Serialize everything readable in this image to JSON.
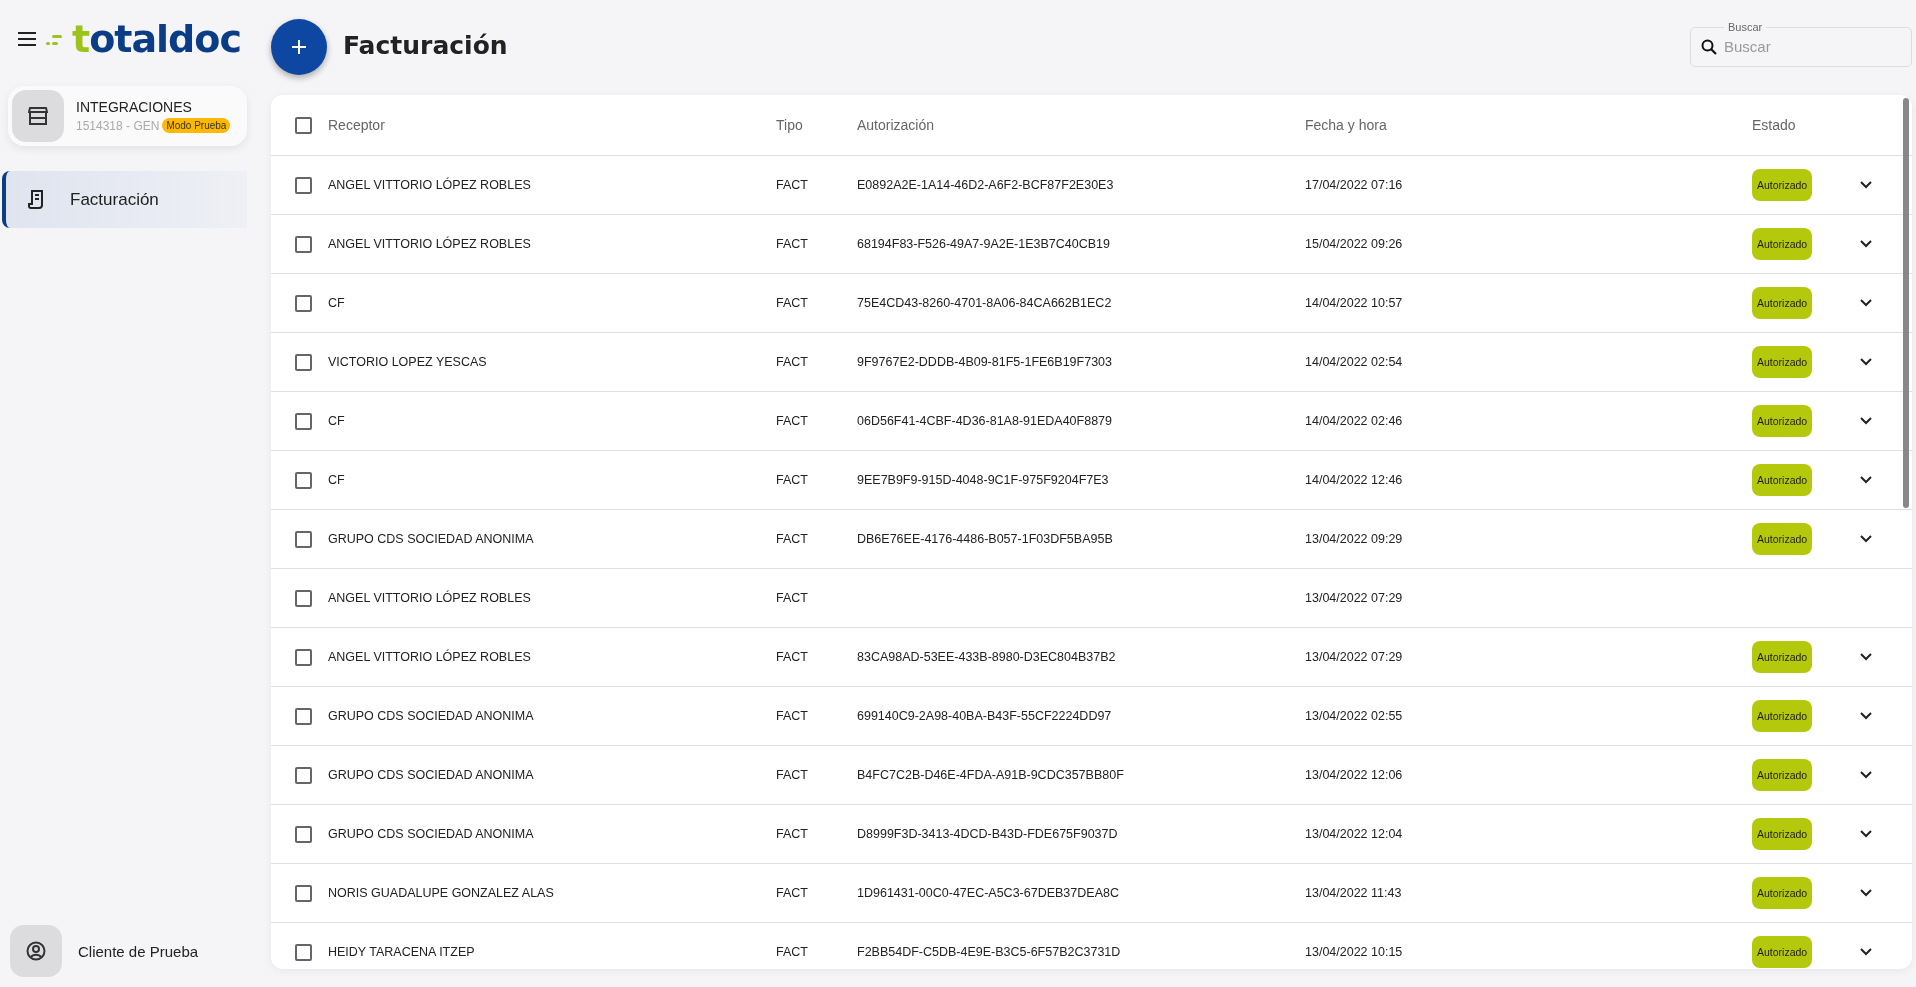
{
  "sidebar": {
    "logo": "totaldoc",
    "account": {
      "name": "INTEGRACIONES",
      "code": "1514318 - GEN",
      "badge": "Modo Prueba"
    },
    "items": [
      {
        "label": "Facturación",
        "selected": true
      }
    ],
    "user": {
      "name": "Cliente de Prueba"
    }
  },
  "header": {
    "title": "Facturación",
    "search": {
      "label": "Buscar",
      "placeholder": "Buscar"
    }
  },
  "table": {
    "select_all": {
      "checked": false
    },
    "columns": [
      "Receptor",
      "Tipo",
      "Autorización",
      "Fecha y hora",
      "Estado"
    ],
    "rows": [
      {
        "checked": false,
        "receptor": "ANGEL VITTORIO LÓPEZ ROBLES",
        "tipo": "FACT",
        "autorizacion": "E0892A2E-1A14-46D2-A6F2-BCF87F2E30E3",
        "fecha": "17/04/2022 07:16",
        "estado": "Autorizado",
        "expandable": true
      },
      {
        "checked": false,
        "receptor": "ANGEL VITTORIO LÓPEZ ROBLES",
        "tipo": "FACT",
        "autorizacion": "68194F83-F526-49A7-9A2E-1E3B7C40CB19",
        "fecha": "15/04/2022 09:26",
        "estado": "Autorizado",
        "expandable": true
      },
      {
        "checked": false,
        "receptor": "CF",
        "tipo": "FACT",
        "autorizacion": "75E4CD43-8260-4701-8A06-84CA662B1EC2",
        "fecha": "14/04/2022 10:57",
        "estado": "Autorizado",
        "expandable": true
      },
      {
        "checked": false,
        "receptor": "VICTORIO LOPEZ YESCAS",
        "tipo": "FACT",
        "autorizacion": "9F9767E2-DDDB-4B09-81F5-1FE6B19F7303",
        "fecha": "14/04/2022 02:54",
        "estado": "Autorizado",
        "expandable": true
      },
      {
        "checked": false,
        "receptor": "CF",
        "tipo": "FACT",
        "autorizacion": "06D56F41-4CBF-4D36-81A8-91EDA40F8879",
        "fecha": "14/04/2022 02:46",
        "estado": "Autorizado",
        "expandable": true
      },
      {
        "checked": false,
        "receptor": "CF",
        "tipo": "FACT",
        "autorizacion": "9EE7B9F9-915D-4048-9C1F-975F9204F7E3",
        "fecha": "14/04/2022 12:46",
        "estado": "Autorizado",
        "expandable": true
      },
      {
        "checked": false,
        "receptor": "GRUPO CDS SOCIEDAD ANONIMA",
        "tipo": "FACT",
        "autorizacion": "DB6E76EE-4176-4486-B057-1F03DF5BA95B",
        "fecha": "13/04/2022 09:29",
        "estado": "Autorizado",
        "expandable": true
      },
      {
        "checked": false,
        "receptor": "ANGEL VITTORIO LÓPEZ ROBLES",
        "tipo": "FACT",
        "fecha": "13/04/2022 07:29",
        "expandable": false
      },
      {
        "checked": false,
        "receptor": "ANGEL VITTORIO LÓPEZ ROBLES",
        "tipo": "FACT",
        "autorizacion": "83CA98AD-53EE-433B-8980-D3EC804B37B2",
        "fecha": "13/04/2022 07:29",
        "estado": "Autorizado",
        "expandable": true
      },
      {
        "checked": false,
        "receptor": "GRUPO CDS SOCIEDAD ANONIMA",
        "tipo": "FACT",
        "autorizacion": "699140C9-2A98-40BA-B43F-55CF2224DD97",
        "fecha": "13/04/2022 02:55",
        "estado": "Autorizado",
        "expandable": true
      },
      {
        "checked": false,
        "receptor": "GRUPO CDS SOCIEDAD ANONIMA",
        "tipo": "FACT",
        "autorizacion": "B4FC7C2B-D46E-4FDA-A91B-9CDC357BB80F",
        "fecha": "13/04/2022 12:06",
        "estado": "Autorizado",
        "expandable": true
      },
      {
        "checked": false,
        "receptor": "GRUPO CDS SOCIEDAD ANONIMA",
        "tipo": "FACT",
        "autorizacion": "D8999F3D-3413-4DCD-B43D-FDE675F9037D",
        "fecha": "13/04/2022 12:04",
        "estado": "Autorizado",
        "expandable": true
      },
      {
        "checked": false,
        "receptor": "NORIS GUADALUPE GONZALEZ ALAS",
        "tipo": "FACT",
        "autorizacion": "1D961431-00C0-47EC-A5C3-67DEB37DEA8C",
        "fecha": "13/04/2022 11:43",
        "estado": "Autorizado",
        "expandable": true
      },
      {
        "checked": false,
        "receptor": "HEIDY TARACENA ITZEP",
        "tipo": "FACT",
        "autorizacion": "F2BB54DF-C5DB-4E9E-B3C5-6F57B2C3731D",
        "fecha": "13/04/2022 10:15",
        "estado": "Autorizado",
        "expandable": true
      }
    ]
  }
}
